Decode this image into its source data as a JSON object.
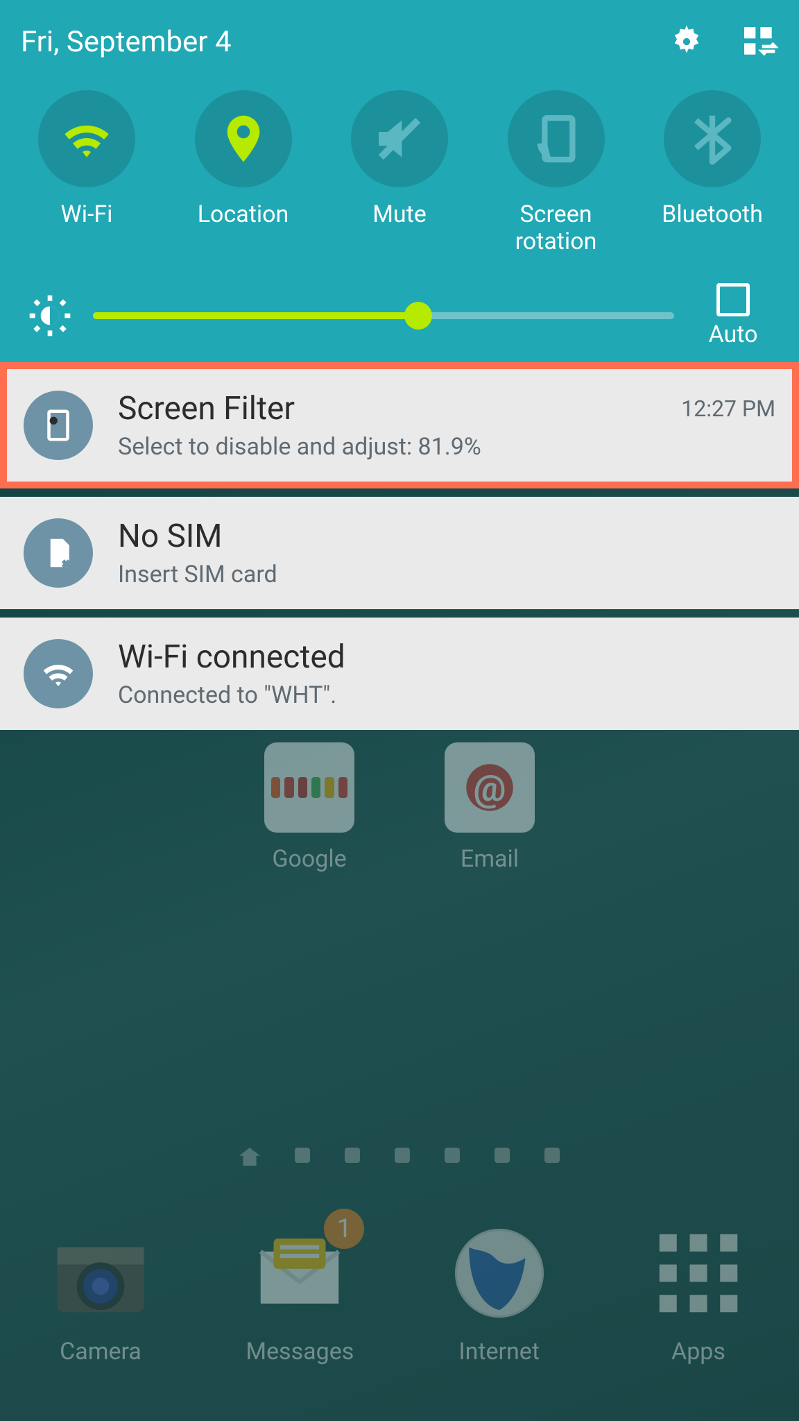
{
  "topbar": {
    "date": "Fri, September 4"
  },
  "quicktoggles": [
    {
      "id": "wifi",
      "label": "Wi-Fi",
      "active": true
    },
    {
      "id": "location",
      "label": "Location",
      "active": true
    },
    {
      "id": "mute",
      "label": "Mute",
      "active": false
    },
    {
      "id": "screen-rotation",
      "label": "Screen\nrotation",
      "active": false
    },
    {
      "id": "bluetooth",
      "label": "Bluetooth",
      "active": false
    }
  ],
  "brightness": {
    "percent": 56,
    "auto_label": "Auto",
    "auto_checked": false
  },
  "notifications": [
    {
      "id": "screen-filter",
      "title": "Screen Filter",
      "subtitle": "Select to disable and adjust: 81.9%",
      "time": "12:27 PM",
      "highlighted": true
    },
    {
      "id": "no-sim",
      "title": "No SIM",
      "subtitle": "Insert SIM card",
      "time": "",
      "highlighted": false
    },
    {
      "id": "wifi-connected",
      "title": "Wi-Fi connected",
      "subtitle": "Connected to \"WHT\".",
      "time": "",
      "highlighted": false
    }
  ],
  "home": {
    "upper_apps": [
      {
        "id": "google",
        "label": "Google"
      },
      {
        "id": "email",
        "label": "Email"
      }
    ],
    "dock": [
      {
        "id": "camera",
        "label": "Camera",
        "badge": ""
      },
      {
        "id": "messages",
        "label": "Messages",
        "badge": "1"
      },
      {
        "id": "internet",
        "label": "Internet",
        "badge": ""
      },
      {
        "id": "apps",
        "label": "Apps",
        "badge": ""
      }
    ],
    "page_count": 7,
    "active_page": 0
  },
  "colors": {
    "panel": "#20a8b4",
    "accent": "#b6ea00",
    "highlight": "#ff6f4f",
    "notif_badge": "#6e93a6"
  }
}
